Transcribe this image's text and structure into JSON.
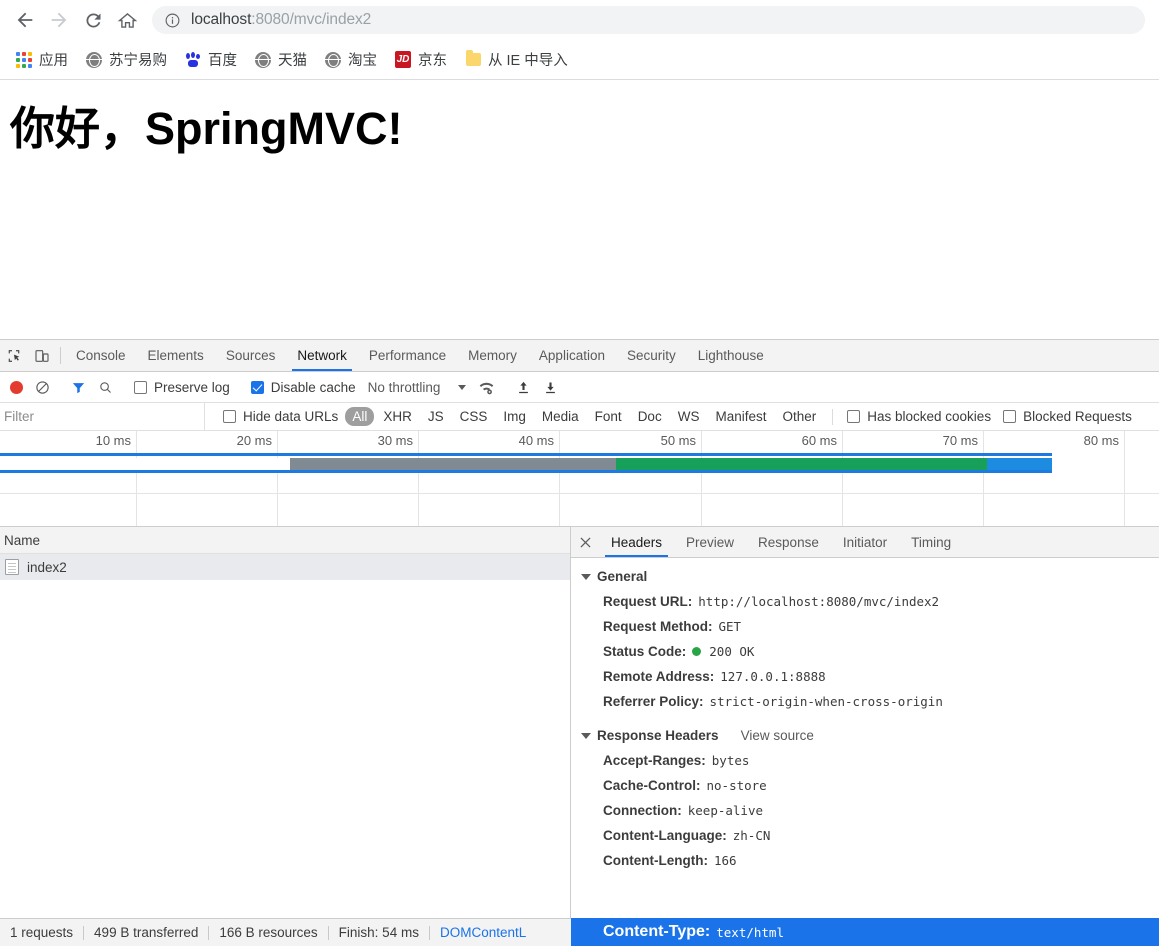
{
  "browser": {
    "nav": {
      "back_icon": "arrow-left-icon",
      "forward_icon": "arrow-right-icon",
      "reload_icon": "reload-icon",
      "home_icon": "home-icon"
    },
    "omnibox": {
      "info_icon": "info-circle-icon",
      "host": "localhost",
      "path": ":8080/mvc/index2",
      "full_url": "localhost:8080/mvc/index2"
    },
    "bookmarks": [
      {
        "label": "应用",
        "icon": "apps-grid-icon"
      },
      {
        "label": "苏宁易购",
        "icon": "globe-icon"
      },
      {
        "label": "百度",
        "icon": "baidu-icon"
      },
      {
        "label": "天猫",
        "icon": "globe-icon"
      },
      {
        "label": "淘宝",
        "icon": "globe-icon"
      },
      {
        "label": "京东",
        "icon": "jd-icon"
      },
      {
        "label": "从 IE 中导入",
        "icon": "folder-icon"
      }
    ]
  },
  "page": {
    "heading": "你好，SpringMVC!"
  },
  "devtools": {
    "inspect_icon": "inspect-element-icon",
    "device_icon": "device-toolbar-icon",
    "tabs": [
      {
        "label": "Console",
        "active": false
      },
      {
        "label": "Elements",
        "active": false
      },
      {
        "label": "Sources",
        "active": false
      },
      {
        "label": "Network",
        "active": true
      },
      {
        "label": "Performance",
        "active": false
      },
      {
        "label": "Memory",
        "active": false
      },
      {
        "label": "Application",
        "active": false
      },
      {
        "label": "Security",
        "active": false
      },
      {
        "label": "Lighthouse",
        "active": false
      }
    ],
    "toolbar": {
      "record_icon": "record-circle-icon",
      "clear_icon": "clear-no-entry-icon",
      "filter_icon": "funnel-filter-icon",
      "search_icon": "magnifier-search-icon",
      "preserve_log_label": "Preserve log",
      "preserve_log_checked": false,
      "disable_cache_label": "Disable cache",
      "disable_cache_checked": true,
      "throttling_label": "No throttling",
      "throttle_caret_icon": "chevron-down-icon",
      "wifi_icon": "wifi-settings-icon",
      "import_icon": "import-har-up-arrow-icon",
      "export_icon": "export-har-down-arrow-icon"
    },
    "filter": {
      "placeholder": "Filter",
      "hide_data_urls_label": "Hide data URLs",
      "hide_data_urls_checked": false,
      "types": [
        "All",
        "XHR",
        "JS",
        "CSS",
        "Img",
        "Media",
        "Font",
        "Doc",
        "WS",
        "Manifest",
        "Other"
      ],
      "active_type": "All",
      "has_blocked_cookies_label": "Has blocked cookies",
      "has_blocked_cookies_checked": false,
      "blocked_requests_label": "Blocked Requests",
      "blocked_requests_checked": false
    },
    "overview": {
      "ticks": [
        "10 ms",
        "20 ms",
        "30 ms",
        "40 ms",
        "50 ms",
        "60 ms",
        "70 ms",
        "80 ms"
      ],
      "segments": [
        {
          "name": "stalled",
          "color": "#ffffff",
          "start_pct": 0,
          "width_pct": 27.6
        },
        {
          "name": "waiting",
          "color": "#808a93",
          "start_pct": 27.6,
          "width_pct": 31.0
        },
        {
          "name": "download",
          "color": "#16a05a",
          "start_pct": 58.6,
          "width_pct": 35.2
        },
        {
          "name": "tail",
          "color": "#1d8ce0",
          "start_pct": 93.8,
          "width_pct": 6.2
        }
      ],
      "line_color": "#1d7ae0"
    },
    "request_list": {
      "column_header": "Name",
      "rows": [
        {
          "name": "index2",
          "icon": "document-icon",
          "selected": true
        }
      ]
    },
    "detail": {
      "close_icon": "close-x-icon",
      "tabs": [
        {
          "label": "Headers",
          "active": true
        },
        {
          "label": "Preview",
          "active": false
        },
        {
          "label": "Response",
          "active": false
        },
        {
          "label": "Initiator",
          "active": false
        },
        {
          "label": "Timing",
          "active": false
        }
      ],
      "general": {
        "title": "General",
        "rows": [
          {
            "key": "Request URL:",
            "value": "http://localhost:8080/mvc/index2"
          },
          {
            "key": "Request Method:",
            "value": "GET"
          },
          {
            "key": "Status Code:",
            "value": "200 OK",
            "status_dot": "#2aa545"
          },
          {
            "key": "Remote Address:",
            "value": "127.0.0.1:8888"
          },
          {
            "key": "Referrer Policy:",
            "value": "strict-origin-when-cross-origin"
          }
        ]
      },
      "response_headers": {
        "title": "Response Headers",
        "view_source": "View source",
        "rows": [
          {
            "key": "Accept-Ranges:",
            "value": "bytes",
            "selected": false
          },
          {
            "key": "Cache-Control:",
            "value": "no-store",
            "selected": false
          },
          {
            "key": "Connection:",
            "value": "keep-alive",
            "selected": false
          },
          {
            "key": "Content-Language:",
            "value": "zh-CN",
            "selected": false
          },
          {
            "key": "Content-Length:",
            "value": "166",
            "selected": false
          },
          {
            "key": "Content-Type:",
            "value": "text/html",
            "selected": true
          }
        ]
      }
    },
    "status_bar": {
      "requests": "1 requests",
      "transferred": "499 B transferred",
      "resources": "166 B resources",
      "finish": "Finish: 54 ms",
      "dom_content_loaded": "DOMContentL",
      "overlay_key": "Content-Type:",
      "overlay_value": "text/html"
    }
  },
  "colors": {
    "accent_blue": "#1a73e8",
    "record_red": "#e33b2e",
    "status_green": "#2aa545",
    "download_green": "#16a05a",
    "waiting_gray": "#808a93"
  }
}
